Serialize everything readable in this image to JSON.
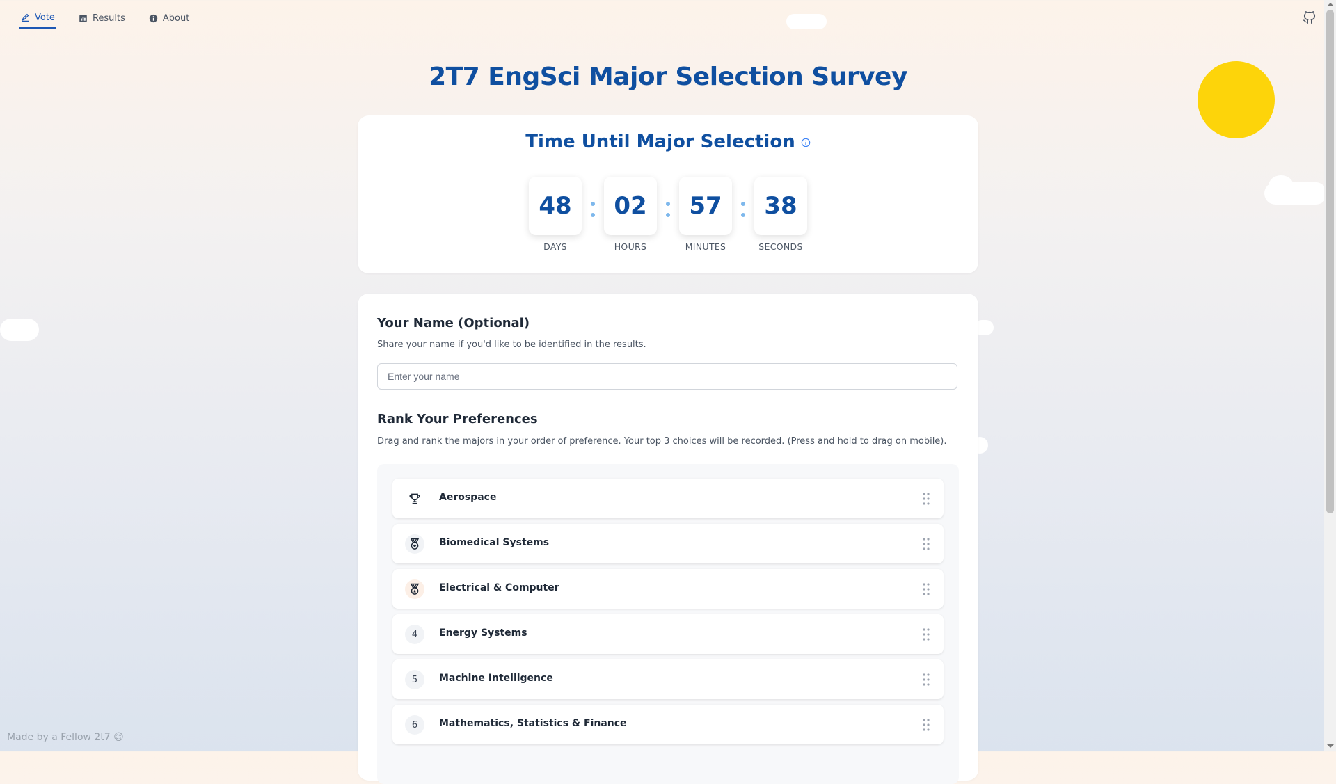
{
  "nav": {
    "items": [
      {
        "label": "Vote",
        "icon": "pen-icon",
        "active": true
      },
      {
        "label": "Results",
        "icon": "bar-chart-icon",
        "active": false
      },
      {
        "label": "About",
        "icon": "info-icon",
        "active": false
      }
    ],
    "github_icon": "github-icon"
  },
  "page": {
    "title": "2T7 EngSci Major Selection Survey"
  },
  "countdown": {
    "title": "Time Until Major Selection",
    "units": [
      {
        "value": "48",
        "label": "DAYS"
      },
      {
        "value": "02",
        "label": "HOURS"
      },
      {
        "value": "57",
        "label": "MINUTES"
      },
      {
        "value": "38",
        "label": "SECONDS"
      }
    ]
  },
  "name_section": {
    "heading": "Your Name (Optional)",
    "description": "Share your name if you'd like to be identified in the results.",
    "input_placeholder": "Enter your name",
    "input_value": ""
  },
  "rank_section": {
    "heading": "Rank Your Preferences",
    "description": "Drag and rank the majors in your order of preference. Your top 3 choices will be recorded. (Press and hold to drag on mobile).",
    "items": [
      {
        "rank": "1",
        "badge": "trophy-icon",
        "label": "Aerospace"
      },
      {
        "rank": "2",
        "badge": "medal-icon",
        "label": "Biomedical Systems"
      },
      {
        "rank": "3",
        "badge": "medal-icon",
        "label": "Electrical & Computer"
      },
      {
        "rank": "4",
        "badge": "",
        "label": "Energy Systems"
      },
      {
        "rank": "5",
        "badge": "",
        "label": "Machine Intelligence"
      },
      {
        "rank": "6",
        "badge": "",
        "label": "Mathematics, Statistics & Finance"
      }
    ]
  },
  "footer": {
    "text": "Made by a Fellow 2t7 😊"
  },
  "colors": {
    "brand": "#0f4fa0",
    "active_nav": "#1e58b4",
    "sun": "#fdd40a"
  }
}
